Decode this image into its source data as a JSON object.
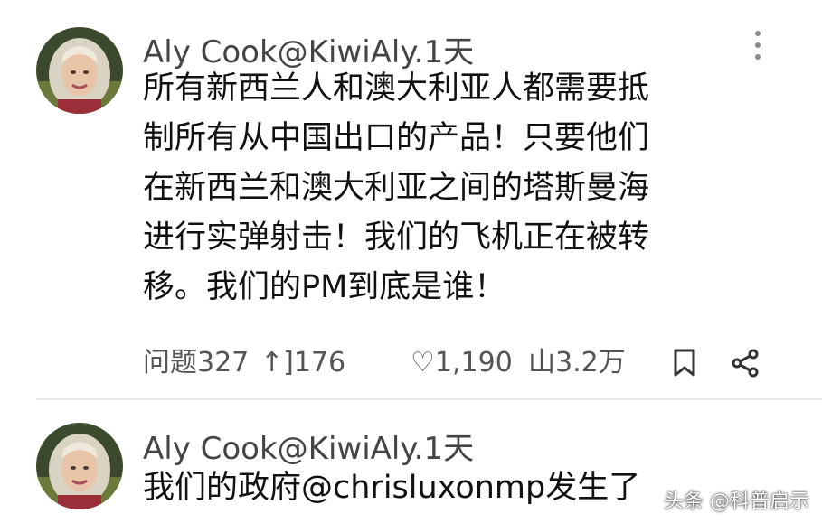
{
  "tweets": [
    {
      "author": "Aly Cook",
      "handle": "@KiwiAly",
      "time": ".1天",
      "lines": [
        "所有新西兰人和澳大利亚人都需要抵",
        "制所有从中国出口的产品！只要他们",
        "在新西兰和澳大利亚之间的塔斯曼海",
        "进行实弹射击！我们的飞机正在被转",
        "移。我们的PM到底是谁！"
      ],
      "actions": {
        "question_label": "问题327",
        "retweet_count": "]176",
        "like_count": "1,190",
        "views_count": "山3.2万"
      }
    },
    {
      "author": "Aly Cook",
      "handle": "@KiwiAly",
      "time": ".1天",
      "lines": [
        "我们的政府@chrisluxonmp发生了"
      ]
    }
  ],
  "watermark": "头条 @科普启示",
  "icons": [
    "more-vertical-icon",
    "retweet-icon",
    "like-icon",
    "bookmark-icon",
    "share-icon"
  ],
  "colors": {
    "text": "#111111",
    "meta": "#444444",
    "action": "#555555",
    "divider": "#e8e8e8"
  }
}
